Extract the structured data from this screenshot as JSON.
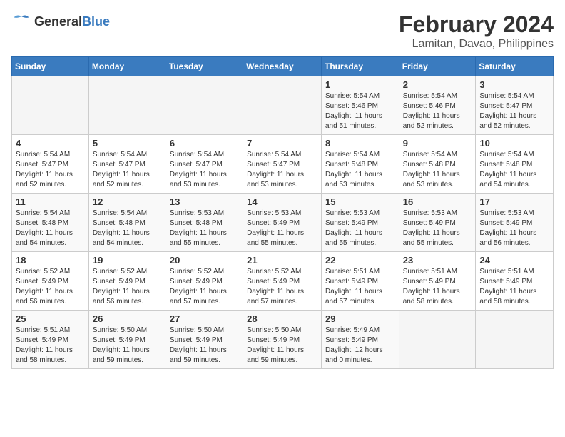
{
  "logo": {
    "general": "General",
    "blue": "Blue"
  },
  "title": "February 2024",
  "subtitle": "Lamitan, Davao, Philippines",
  "weekdays": [
    "Sunday",
    "Monday",
    "Tuesday",
    "Wednesday",
    "Thursday",
    "Friday",
    "Saturday"
  ],
  "weeks": [
    [
      {
        "day": "",
        "info": ""
      },
      {
        "day": "",
        "info": ""
      },
      {
        "day": "",
        "info": ""
      },
      {
        "day": "",
        "info": ""
      },
      {
        "day": "1",
        "info": "Sunrise: 5:54 AM\nSunset: 5:46 PM\nDaylight: 11 hours\nand 51 minutes."
      },
      {
        "day": "2",
        "info": "Sunrise: 5:54 AM\nSunset: 5:46 PM\nDaylight: 11 hours\nand 52 minutes."
      },
      {
        "day": "3",
        "info": "Sunrise: 5:54 AM\nSunset: 5:47 PM\nDaylight: 11 hours\nand 52 minutes."
      }
    ],
    [
      {
        "day": "4",
        "info": "Sunrise: 5:54 AM\nSunset: 5:47 PM\nDaylight: 11 hours\nand 52 minutes."
      },
      {
        "day": "5",
        "info": "Sunrise: 5:54 AM\nSunset: 5:47 PM\nDaylight: 11 hours\nand 52 minutes."
      },
      {
        "day": "6",
        "info": "Sunrise: 5:54 AM\nSunset: 5:47 PM\nDaylight: 11 hours\nand 53 minutes."
      },
      {
        "day": "7",
        "info": "Sunrise: 5:54 AM\nSunset: 5:47 PM\nDaylight: 11 hours\nand 53 minutes."
      },
      {
        "day": "8",
        "info": "Sunrise: 5:54 AM\nSunset: 5:48 PM\nDaylight: 11 hours\nand 53 minutes."
      },
      {
        "day": "9",
        "info": "Sunrise: 5:54 AM\nSunset: 5:48 PM\nDaylight: 11 hours\nand 53 minutes."
      },
      {
        "day": "10",
        "info": "Sunrise: 5:54 AM\nSunset: 5:48 PM\nDaylight: 11 hours\nand 54 minutes."
      }
    ],
    [
      {
        "day": "11",
        "info": "Sunrise: 5:54 AM\nSunset: 5:48 PM\nDaylight: 11 hours\nand 54 minutes."
      },
      {
        "day": "12",
        "info": "Sunrise: 5:54 AM\nSunset: 5:48 PM\nDaylight: 11 hours\nand 54 minutes."
      },
      {
        "day": "13",
        "info": "Sunrise: 5:53 AM\nSunset: 5:48 PM\nDaylight: 11 hours\nand 55 minutes."
      },
      {
        "day": "14",
        "info": "Sunrise: 5:53 AM\nSunset: 5:49 PM\nDaylight: 11 hours\nand 55 minutes."
      },
      {
        "day": "15",
        "info": "Sunrise: 5:53 AM\nSunset: 5:49 PM\nDaylight: 11 hours\nand 55 minutes."
      },
      {
        "day": "16",
        "info": "Sunrise: 5:53 AM\nSunset: 5:49 PM\nDaylight: 11 hours\nand 55 minutes."
      },
      {
        "day": "17",
        "info": "Sunrise: 5:53 AM\nSunset: 5:49 PM\nDaylight: 11 hours\nand 56 minutes."
      }
    ],
    [
      {
        "day": "18",
        "info": "Sunrise: 5:52 AM\nSunset: 5:49 PM\nDaylight: 11 hours\nand 56 minutes."
      },
      {
        "day": "19",
        "info": "Sunrise: 5:52 AM\nSunset: 5:49 PM\nDaylight: 11 hours\nand 56 minutes."
      },
      {
        "day": "20",
        "info": "Sunrise: 5:52 AM\nSunset: 5:49 PM\nDaylight: 11 hours\nand 57 minutes."
      },
      {
        "day": "21",
        "info": "Sunrise: 5:52 AM\nSunset: 5:49 PM\nDaylight: 11 hours\nand 57 minutes."
      },
      {
        "day": "22",
        "info": "Sunrise: 5:51 AM\nSunset: 5:49 PM\nDaylight: 11 hours\nand 57 minutes."
      },
      {
        "day": "23",
        "info": "Sunrise: 5:51 AM\nSunset: 5:49 PM\nDaylight: 11 hours\nand 58 minutes."
      },
      {
        "day": "24",
        "info": "Sunrise: 5:51 AM\nSunset: 5:49 PM\nDaylight: 11 hours\nand 58 minutes."
      }
    ],
    [
      {
        "day": "25",
        "info": "Sunrise: 5:51 AM\nSunset: 5:49 PM\nDaylight: 11 hours\nand 58 minutes."
      },
      {
        "day": "26",
        "info": "Sunrise: 5:50 AM\nSunset: 5:49 PM\nDaylight: 11 hours\nand 59 minutes."
      },
      {
        "day": "27",
        "info": "Sunrise: 5:50 AM\nSunset: 5:49 PM\nDaylight: 11 hours\nand 59 minutes."
      },
      {
        "day": "28",
        "info": "Sunrise: 5:50 AM\nSunset: 5:49 PM\nDaylight: 11 hours\nand 59 minutes."
      },
      {
        "day": "29",
        "info": "Sunrise: 5:49 AM\nSunset: 5:49 PM\nDaylight: 12 hours\nand 0 minutes."
      },
      {
        "day": "",
        "info": ""
      },
      {
        "day": "",
        "info": ""
      }
    ]
  ]
}
